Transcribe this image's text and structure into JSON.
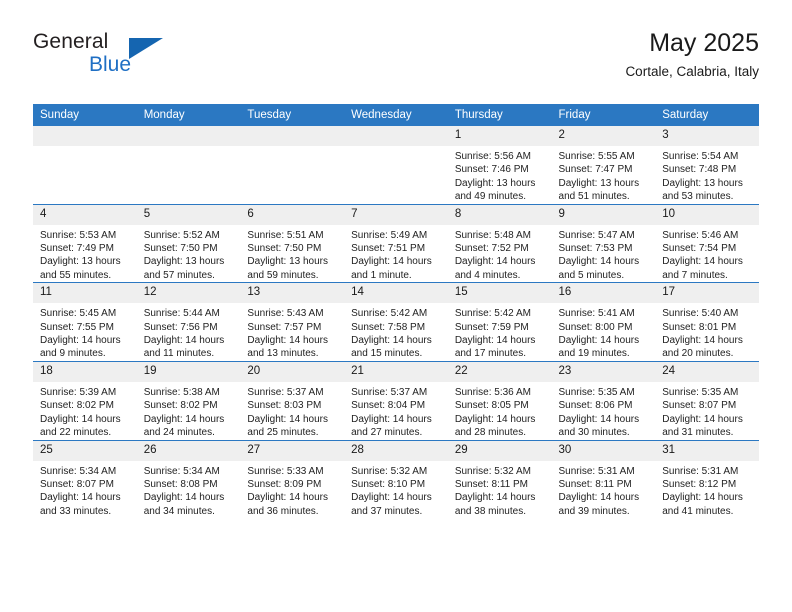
{
  "brand": {
    "name_part1": "General",
    "name_part2": "Blue",
    "logo_icon": "triangle-flag-icon",
    "accent_color": "#1565b0"
  },
  "header": {
    "title": "May 2025",
    "subtitle": "Cortale, Calabria, Italy"
  },
  "theme": {
    "header_blue": "#2b78c2",
    "daynum_gray": "#efefef",
    "text_dark": "#1a1a1a"
  },
  "weekdays": [
    "Sunday",
    "Monday",
    "Tuesday",
    "Wednesday",
    "Thursday",
    "Friday",
    "Saturday"
  ],
  "weeks": [
    [
      {
        "day": "",
        "empty": true,
        "sunrise": "",
        "sunset": "",
        "daylight": ""
      },
      {
        "day": "",
        "empty": true,
        "sunrise": "",
        "sunset": "",
        "daylight": ""
      },
      {
        "day": "",
        "empty": true,
        "sunrise": "",
        "sunset": "",
        "daylight": ""
      },
      {
        "day": "",
        "empty": true,
        "sunrise": "",
        "sunset": "",
        "daylight": ""
      },
      {
        "day": "1",
        "sunrise": "Sunrise: 5:56 AM",
        "sunset": "Sunset: 7:46 PM",
        "daylight": "Daylight: 13 hours and 49 minutes."
      },
      {
        "day": "2",
        "sunrise": "Sunrise: 5:55 AM",
        "sunset": "Sunset: 7:47 PM",
        "daylight": "Daylight: 13 hours and 51 minutes."
      },
      {
        "day": "3",
        "sunrise": "Sunrise: 5:54 AM",
        "sunset": "Sunset: 7:48 PM",
        "daylight": "Daylight: 13 hours and 53 minutes."
      }
    ],
    [
      {
        "day": "4",
        "sunrise": "Sunrise: 5:53 AM",
        "sunset": "Sunset: 7:49 PM",
        "daylight": "Daylight: 13 hours and 55 minutes."
      },
      {
        "day": "5",
        "sunrise": "Sunrise: 5:52 AM",
        "sunset": "Sunset: 7:50 PM",
        "daylight": "Daylight: 13 hours and 57 minutes."
      },
      {
        "day": "6",
        "sunrise": "Sunrise: 5:51 AM",
        "sunset": "Sunset: 7:50 PM",
        "daylight": "Daylight: 13 hours and 59 minutes."
      },
      {
        "day": "7",
        "sunrise": "Sunrise: 5:49 AM",
        "sunset": "Sunset: 7:51 PM",
        "daylight": "Daylight: 14 hours and 1 minute."
      },
      {
        "day": "8",
        "sunrise": "Sunrise: 5:48 AM",
        "sunset": "Sunset: 7:52 PM",
        "daylight": "Daylight: 14 hours and 4 minutes."
      },
      {
        "day": "9",
        "sunrise": "Sunrise: 5:47 AM",
        "sunset": "Sunset: 7:53 PM",
        "daylight": "Daylight: 14 hours and 5 minutes."
      },
      {
        "day": "10",
        "sunrise": "Sunrise: 5:46 AM",
        "sunset": "Sunset: 7:54 PM",
        "daylight": "Daylight: 14 hours and 7 minutes."
      }
    ],
    [
      {
        "day": "11",
        "sunrise": "Sunrise: 5:45 AM",
        "sunset": "Sunset: 7:55 PM",
        "daylight": "Daylight: 14 hours and 9 minutes."
      },
      {
        "day": "12",
        "sunrise": "Sunrise: 5:44 AM",
        "sunset": "Sunset: 7:56 PM",
        "daylight": "Daylight: 14 hours and 11 minutes."
      },
      {
        "day": "13",
        "sunrise": "Sunrise: 5:43 AM",
        "sunset": "Sunset: 7:57 PM",
        "daylight": "Daylight: 14 hours and 13 minutes."
      },
      {
        "day": "14",
        "sunrise": "Sunrise: 5:42 AM",
        "sunset": "Sunset: 7:58 PM",
        "daylight": "Daylight: 14 hours and 15 minutes."
      },
      {
        "day": "15",
        "sunrise": "Sunrise: 5:42 AM",
        "sunset": "Sunset: 7:59 PM",
        "daylight": "Daylight: 14 hours and 17 minutes."
      },
      {
        "day": "16",
        "sunrise": "Sunrise: 5:41 AM",
        "sunset": "Sunset: 8:00 PM",
        "daylight": "Daylight: 14 hours and 19 minutes."
      },
      {
        "day": "17",
        "sunrise": "Sunrise: 5:40 AM",
        "sunset": "Sunset: 8:01 PM",
        "daylight": "Daylight: 14 hours and 20 minutes."
      }
    ],
    [
      {
        "day": "18",
        "sunrise": "Sunrise: 5:39 AM",
        "sunset": "Sunset: 8:02 PM",
        "daylight": "Daylight: 14 hours and 22 minutes."
      },
      {
        "day": "19",
        "sunrise": "Sunrise: 5:38 AM",
        "sunset": "Sunset: 8:02 PM",
        "daylight": "Daylight: 14 hours and 24 minutes."
      },
      {
        "day": "20",
        "sunrise": "Sunrise: 5:37 AM",
        "sunset": "Sunset: 8:03 PM",
        "daylight": "Daylight: 14 hours and 25 minutes."
      },
      {
        "day": "21",
        "sunrise": "Sunrise: 5:37 AM",
        "sunset": "Sunset: 8:04 PM",
        "daylight": "Daylight: 14 hours and 27 minutes."
      },
      {
        "day": "22",
        "sunrise": "Sunrise: 5:36 AM",
        "sunset": "Sunset: 8:05 PM",
        "daylight": "Daylight: 14 hours and 28 minutes."
      },
      {
        "day": "23",
        "sunrise": "Sunrise: 5:35 AM",
        "sunset": "Sunset: 8:06 PM",
        "daylight": "Daylight: 14 hours and 30 minutes."
      },
      {
        "day": "24",
        "sunrise": "Sunrise: 5:35 AM",
        "sunset": "Sunset: 8:07 PM",
        "daylight": "Daylight: 14 hours and 31 minutes."
      }
    ],
    [
      {
        "day": "25",
        "sunrise": "Sunrise: 5:34 AM",
        "sunset": "Sunset: 8:07 PM",
        "daylight": "Daylight: 14 hours and 33 minutes."
      },
      {
        "day": "26",
        "sunrise": "Sunrise: 5:34 AM",
        "sunset": "Sunset: 8:08 PM",
        "daylight": "Daylight: 14 hours and 34 minutes."
      },
      {
        "day": "27",
        "sunrise": "Sunrise: 5:33 AM",
        "sunset": "Sunset: 8:09 PM",
        "daylight": "Daylight: 14 hours and 36 minutes."
      },
      {
        "day": "28",
        "sunrise": "Sunrise: 5:32 AM",
        "sunset": "Sunset: 8:10 PM",
        "daylight": "Daylight: 14 hours and 37 minutes."
      },
      {
        "day": "29",
        "sunrise": "Sunrise: 5:32 AM",
        "sunset": "Sunset: 8:11 PM",
        "daylight": "Daylight: 14 hours and 38 minutes."
      },
      {
        "day": "30",
        "sunrise": "Sunrise: 5:31 AM",
        "sunset": "Sunset: 8:11 PM",
        "daylight": "Daylight: 14 hours and 39 minutes."
      },
      {
        "day": "31",
        "sunrise": "Sunrise: 5:31 AM",
        "sunset": "Sunset: 8:12 PM",
        "daylight": "Daylight: 14 hours and 41 minutes."
      }
    ]
  ]
}
